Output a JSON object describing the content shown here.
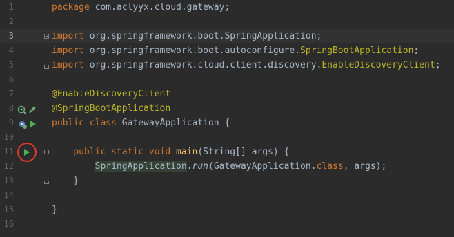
{
  "theme": {
    "background": "#2b2b2b",
    "caret_line": "#323232",
    "line_number": "#606366",
    "line_number_active": "#a4a3a3",
    "text": "#a9b7c6",
    "keyword": "#cc7832",
    "annotation": "#bbb529",
    "class_ref": "#bbb529",
    "method": "#ffc66d",
    "usage_highlight": "#344134",
    "run_green": "#4caf50",
    "highlight_red": "#e03a2c"
  },
  "lines": [
    {
      "n": "1",
      "tokens": [
        {
          "t": "package",
          "c": "kw"
        },
        {
          "t": " com.aclyyx.cloud.gateway;",
          "c": ""
        }
      ]
    },
    {
      "n": "2",
      "tokens": []
    },
    {
      "n": "3",
      "tokens": [
        {
          "t": "import",
          "c": "kw"
        },
        {
          "t": " org.springframework.boot.SpringApplication;",
          "c": ""
        }
      ]
    },
    {
      "n": "4",
      "tokens": [
        {
          "t": "import",
          "c": "kw"
        },
        {
          "t": " org.springframework.boot.autoconfigure.",
          "c": ""
        },
        {
          "t": "SpringBootApplication",
          "c": "str"
        },
        {
          "t": ";",
          "c": ""
        }
      ]
    },
    {
      "n": "5",
      "tokens": [
        {
          "t": "import",
          "c": "kw"
        },
        {
          "t": " org.springframework.cloud.client.discovery.",
          "c": ""
        },
        {
          "t": "EnableDiscoveryClient",
          "c": "str"
        },
        {
          "t": ";",
          "c": ""
        }
      ]
    },
    {
      "n": "6",
      "tokens": []
    },
    {
      "n": "7",
      "tokens": [
        {
          "t": "@EnableDiscoveryClient",
          "c": "ann"
        }
      ]
    },
    {
      "n": "8",
      "tokens": [
        {
          "t": "@SpringBootApplication",
          "c": "ann"
        }
      ]
    },
    {
      "n": "9",
      "tokens": [
        {
          "t": "public class",
          "c": "kw"
        },
        {
          "t": " GatewayApplication {",
          "c": ""
        }
      ]
    },
    {
      "n": "10",
      "tokens": []
    },
    {
      "n": "11",
      "tokens": [
        {
          "t": "    ",
          "c": ""
        },
        {
          "t": "public static void",
          "c": "kw"
        },
        {
          "t": " ",
          "c": ""
        },
        {
          "t": "main",
          "c": "meth"
        },
        {
          "t": "(String[] args) {",
          "c": ""
        }
      ]
    },
    {
      "n": "12",
      "tokens": [
        {
          "t": "        ",
          "c": ""
        },
        {
          "t": "SpringApplication",
          "c": "hl"
        },
        {
          "t": ".",
          "c": ""
        },
        {
          "t": "run",
          "c": "italic"
        },
        {
          "t": "(GatewayApplication.",
          "c": ""
        },
        {
          "t": "class",
          "c": "kw"
        },
        {
          "t": ", args);",
          "c": ""
        }
      ]
    },
    {
      "n": "13",
      "tokens": [
        {
          "t": "    }",
          "c": ""
        }
      ]
    },
    {
      "n": "14",
      "tokens": []
    },
    {
      "n": "15",
      "tokens": [
        {
          "t": "}",
          "c": ""
        }
      ]
    },
    {
      "n": "16",
      "tokens": []
    }
  ],
  "active_line": "3",
  "gutter_icons": {
    "line8": [
      "spring-bean-icon",
      "spring-beans-icon"
    ],
    "line9": [
      "spring-run-config-icon",
      "run-class-icon"
    ],
    "line11": [
      "run-main-icon"
    ]
  }
}
